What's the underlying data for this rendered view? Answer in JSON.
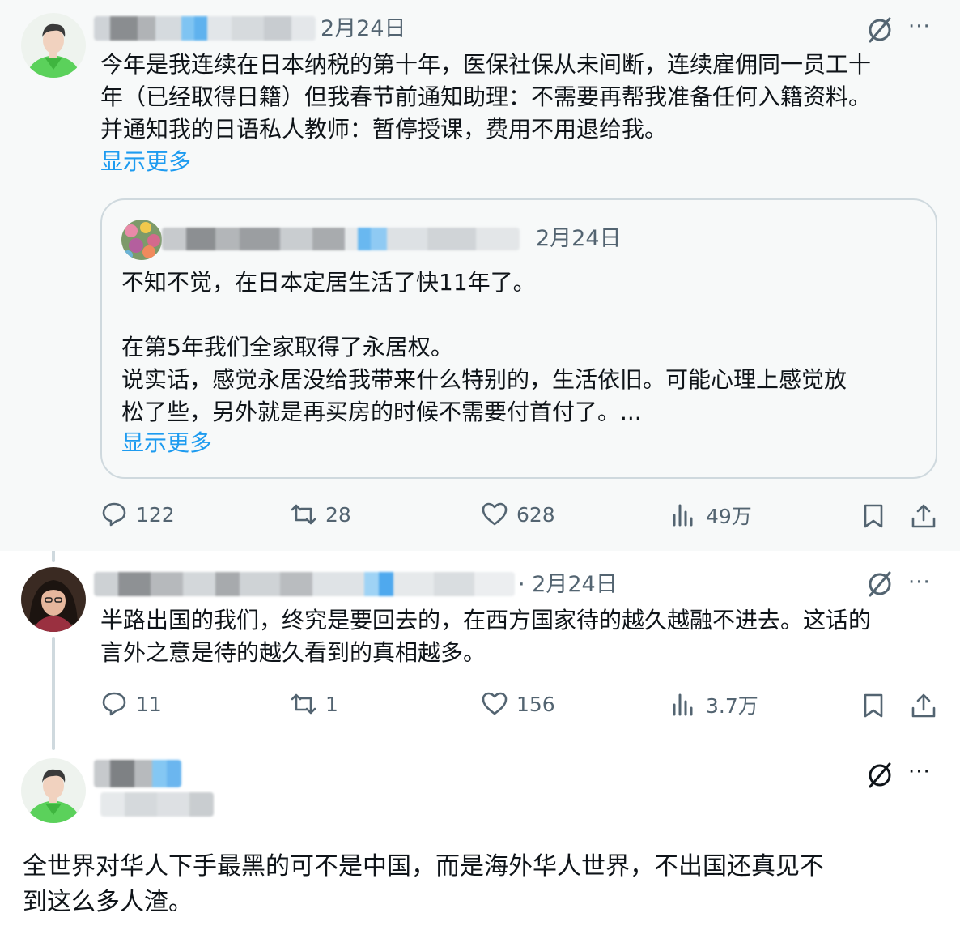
{
  "post1": {
    "date": "2月24日",
    "lines": [
      "今年是我连续在日本纳税的第十年，医保社保从未间断，连续雇佣同一员工十",
      "年（已经取得日籍）但我春节前通知助理：不需要再帮我准备任何入籍资料。",
      "并通知我的日语私人教师：暂停授课，费用不用退给我。"
    ],
    "show_more": "显示更多",
    "quote": {
      "date": "2月24日",
      "lines": [
        "不知不觉，在日本定居生活了快11年了。",
        "",
        "在第5年我们全家取得了永居权。",
        "说实话，感觉永居没给我带来什么特别的，生活依旧。可能心理上感觉放",
        "松了些，另外就是再买房的时候不需要付首付了。..."
      ],
      "show_more": "显示更多"
    },
    "stats": {
      "replies": "122",
      "reposts": "28",
      "likes": "628",
      "views": "49万"
    }
  },
  "post2": {
    "date": "· 2月24日",
    "lines": [
      "半路出国的我们，终究是要回去的，在西方国家待的越久越融不进去。这话的",
      "言外之意是待的越久看到的真相越多。"
    ],
    "stats": {
      "replies": "11",
      "reposts": "1",
      "likes": "156",
      "views": "3.7万"
    }
  },
  "post3": {
    "lines": [
      "全世界对华人下手最黑的可不是中国，而是海外华人世界，不出国还真见不",
      "到这么多人渣。"
    ]
  },
  "icons": {
    "grok": "grok-icon",
    "more": "more-icon",
    "reply": "reply-icon",
    "repost": "repost-icon",
    "like": "like-icon",
    "views": "views-icon",
    "bookmark": "bookmark-icon",
    "share": "share-icon"
  },
  "colors": {
    "link": "#1d9bf0",
    "muted": "#536471",
    "text": "#0f1419",
    "highlight_bg": "#f7f9f9"
  }
}
